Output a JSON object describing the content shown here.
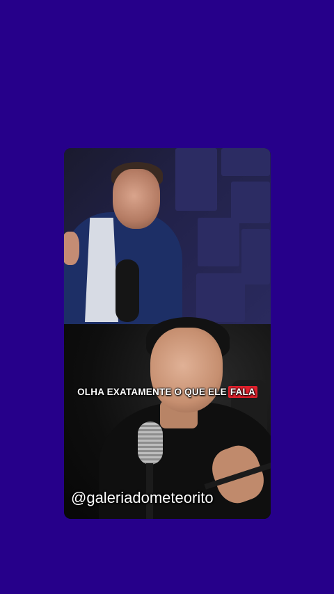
{
  "caption": {
    "prefix": "OLHA EXATAMENTE O QUE ELE",
    "highlight": "FALA"
  },
  "handle": "@galeriadometeorito",
  "colors": {
    "background": "#26008a",
    "caption_highlight": "#e0202c"
  }
}
